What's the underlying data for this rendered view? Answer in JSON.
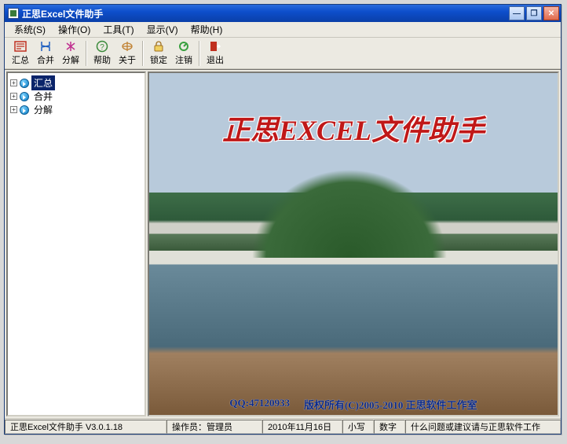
{
  "window": {
    "title": "正思Excel文件助手"
  },
  "menubar": [
    {
      "label": "系统(S)"
    },
    {
      "label": "操作(O)"
    },
    {
      "label": "工具(T)"
    },
    {
      "label": "显示(V)"
    },
    {
      "label": "帮助(H)"
    }
  ],
  "toolbar": {
    "groups": [
      [
        {
          "name": "summary",
          "label": "汇总",
          "icon": "summary-icon",
          "color": "#c03020"
        },
        {
          "name": "merge",
          "label": "合并",
          "icon": "merge-icon",
          "color": "#2060c0"
        },
        {
          "name": "split",
          "label": "分解",
          "icon": "split-icon",
          "color": "#c03090"
        }
      ],
      [
        {
          "name": "help",
          "label": "帮助",
          "icon": "help-icon",
          "color": "#3a8a3a"
        },
        {
          "name": "about",
          "label": "关于",
          "icon": "about-icon",
          "color": "#c08030"
        }
      ],
      [
        {
          "name": "lock",
          "label": "锁定",
          "icon": "lock-icon",
          "color": "#c09020"
        },
        {
          "name": "logout",
          "label": "注销",
          "icon": "logout-icon",
          "color": "#3aa040"
        }
      ],
      [
        {
          "name": "exit",
          "label": "退出",
          "icon": "exit-icon",
          "color": "#c03020"
        }
      ]
    ]
  },
  "tree": {
    "items": [
      {
        "label": "汇总",
        "selected": true
      },
      {
        "label": "合并",
        "selected": false
      },
      {
        "label": "分解",
        "selected": false
      }
    ]
  },
  "viewer": {
    "headline": "正思EXCEL文件助手",
    "qq": "QQ:47120933",
    "copyright": "版权所有(C)2005-2010  正思软件工作室"
  },
  "statusbar": {
    "product": "正思Excel文件助手 V3.0.1.18",
    "operator": "操作员：管理员",
    "date": "2010年11月16日",
    "caps": "小写",
    "num": "数字",
    "message": "什么问题或建议请与正思软件工作"
  }
}
